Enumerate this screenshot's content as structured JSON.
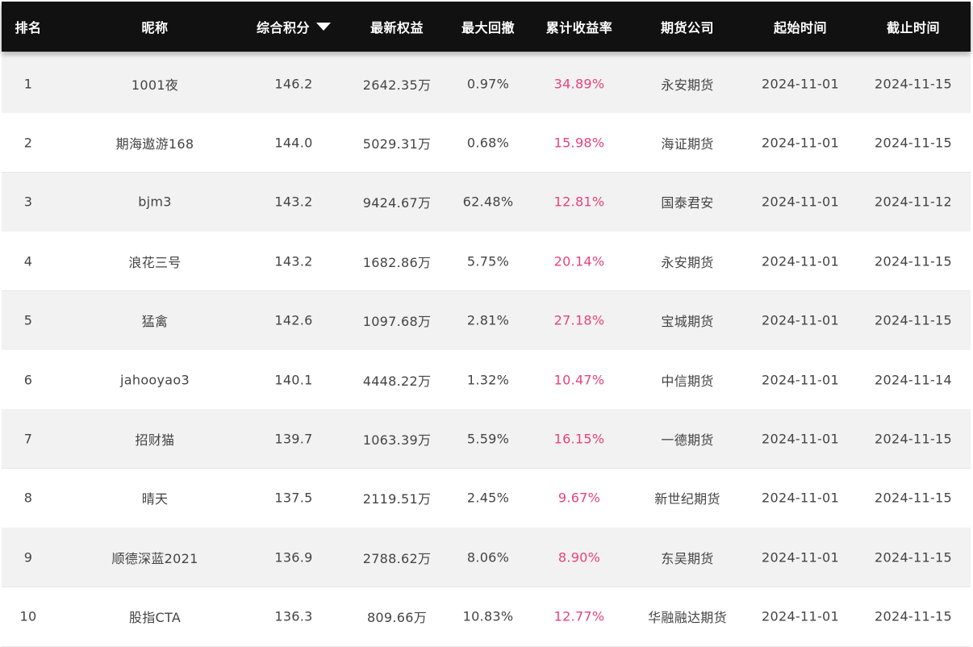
{
  "table": {
    "headers": {
      "rank": "排名",
      "name": "昵称",
      "score": "综合积分",
      "equity": "最新权益",
      "drawdown": "最大回撤",
      "return": "累计收益率",
      "broker": "期货公司",
      "start": "起始时间",
      "end": "截止时间"
    },
    "sort_icon": "caret-down-icon",
    "colors": {
      "header_bg": "#111111",
      "row_alt_bg": "#f2f2f2",
      "return_color": "#e8437a",
      "text": "#444444"
    },
    "rows": [
      {
        "rank": "1",
        "name": "1001夜",
        "score": "146.2",
        "equity": "2642.35万",
        "drawdown": "0.97%",
        "return": "34.89%",
        "broker": "永安期货",
        "start": "2024-11-01",
        "end": "2024-11-15"
      },
      {
        "rank": "2",
        "name": "期海遨游168",
        "score": "144.0",
        "equity": "5029.31万",
        "drawdown": "0.68%",
        "return": "15.98%",
        "broker": "海证期货",
        "start": "2024-11-01",
        "end": "2024-11-15"
      },
      {
        "rank": "3",
        "name": "bjm3",
        "score": "143.2",
        "equity": "9424.67万",
        "drawdown": "62.48%",
        "return": "12.81%",
        "broker": "国泰君安",
        "start": "2024-11-01",
        "end": "2024-11-12"
      },
      {
        "rank": "4",
        "name": "浪花三号",
        "score": "143.2",
        "equity": "1682.86万",
        "drawdown": "5.75%",
        "return": "20.14%",
        "broker": "永安期货",
        "start": "2024-11-01",
        "end": "2024-11-15"
      },
      {
        "rank": "5",
        "name": "猛禽",
        "score": "142.6",
        "equity": "1097.68万",
        "drawdown": "2.81%",
        "return": "27.18%",
        "broker": "宝城期货",
        "start": "2024-11-01",
        "end": "2024-11-15"
      },
      {
        "rank": "6",
        "name": "jahooyao3",
        "score": "140.1",
        "equity": "4448.22万",
        "drawdown": "1.32%",
        "return": "10.47%",
        "broker": "中信期货",
        "start": "2024-11-01",
        "end": "2024-11-14"
      },
      {
        "rank": "7",
        "name": "招财猫",
        "score": "139.7",
        "equity": "1063.39万",
        "drawdown": "5.59%",
        "return": "16.15%",
        "broker": "一德期货",
        "start": "2024-11-01",
        "end": "2024-11-15"
      },
      {
        "rank": "8",
        "name": "晴天",
        "score": "137.5",
        "equity": "2119.51万",
        "drawdown": "2.45%",
        "return": "9.67%",
        "broker": "新世纪期货",
        "start": "2024-11-01",
        "end": "2024-11-15"
      },
      {
        "rank": "9",
        "name": "顺德深蓝2021",
        "score": "136.9",
        "equity": "2788.62万",
        "drawdown": "8.06%",
        "return": "8.90%",
        "broker": "东吴期货",
        "start": "2024-11-01",
        "end": "2024-11-15"
      },
      {
        "rank": "10",
        "name": "股指CTA",
        "score": "136.3",
        "equity": "809.66万",
        "drawdown": "10.83%",
        "return": "12.77%",
        "broker": "华融融达期货",
        "start": "2024-11-01",
        "end": "2024-11-15"
      }
    ]
  }
}
